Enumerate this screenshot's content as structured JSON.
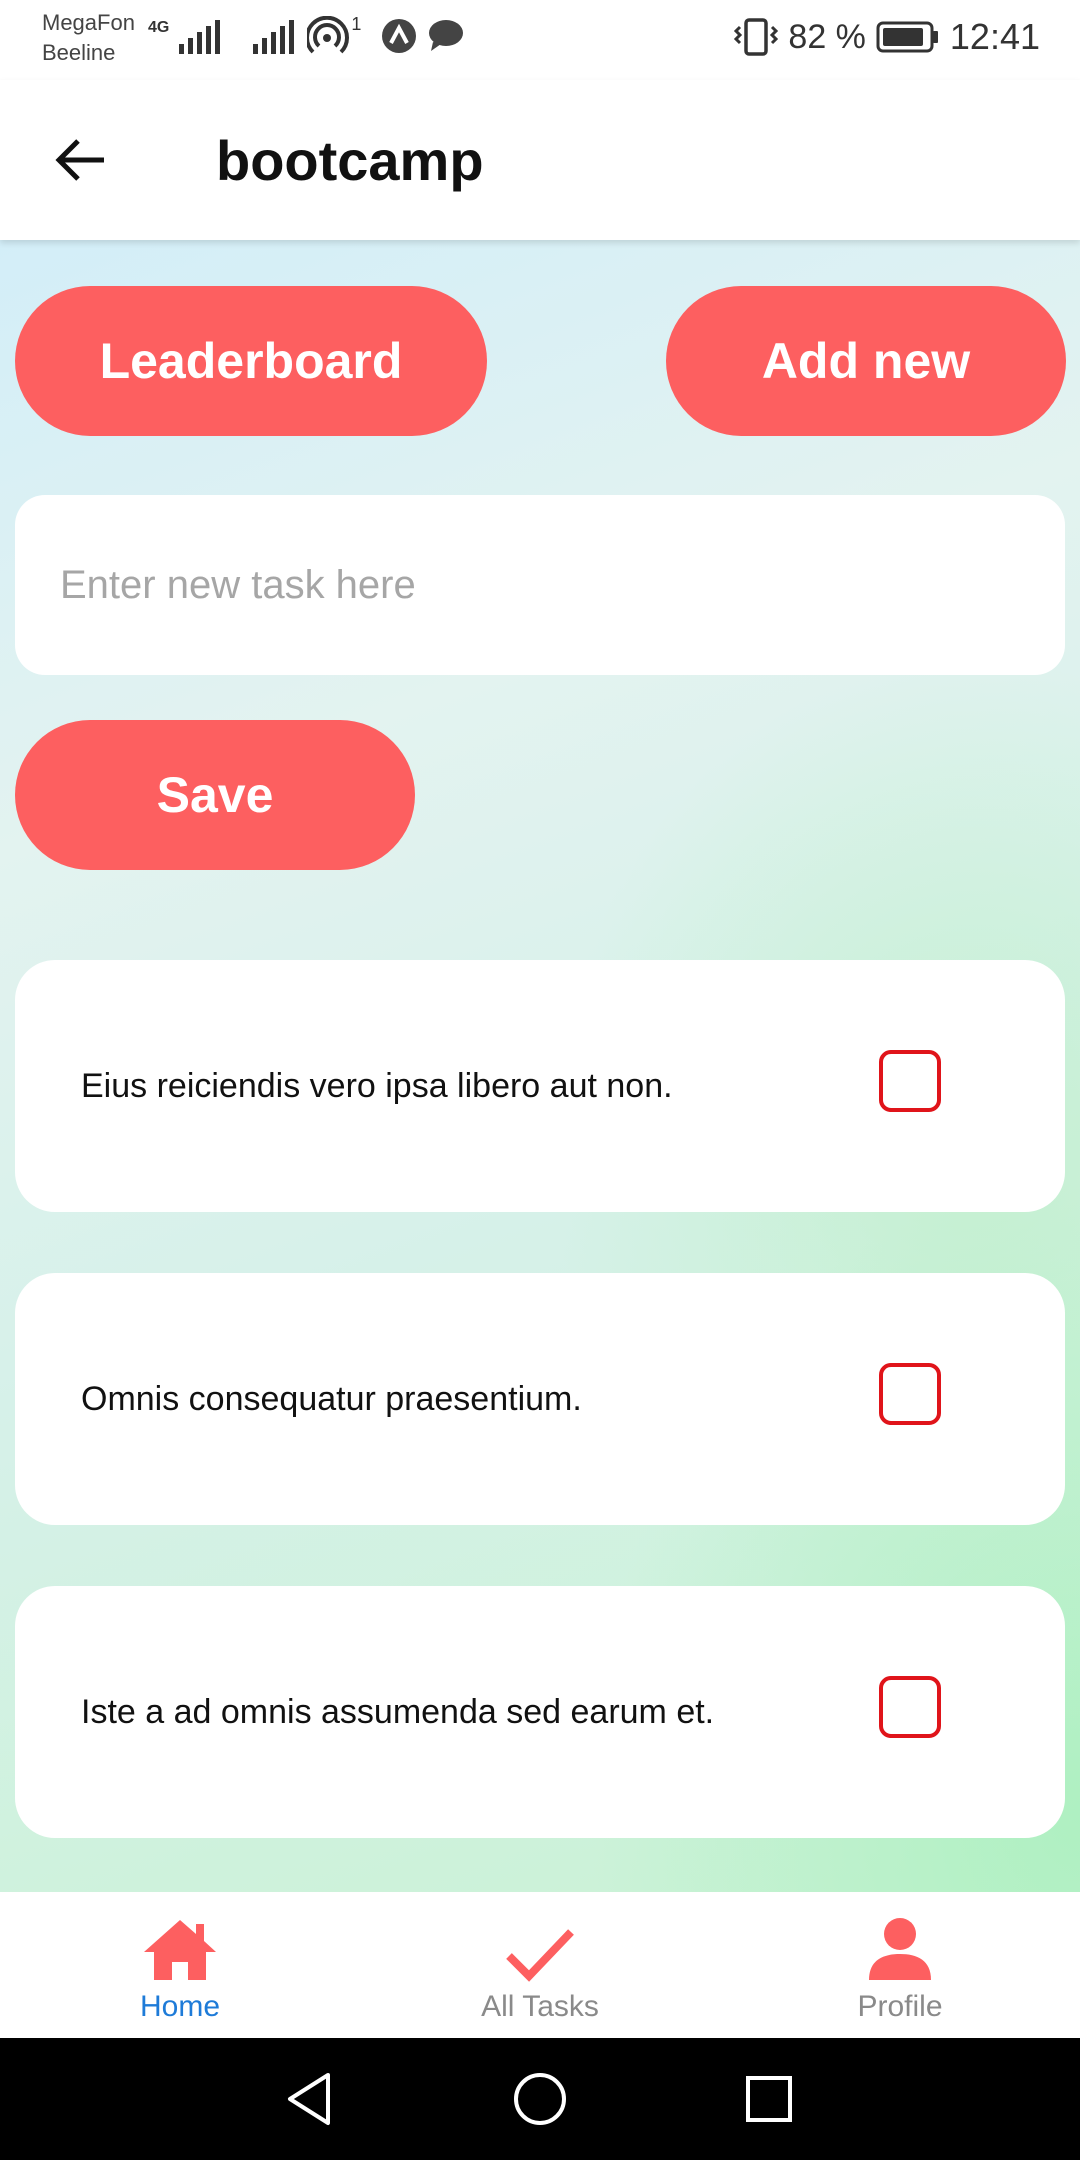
{
  "status_bar": {
    "carrier_1": "MegaFon",
    "carrier_2": "Beeline",
    "network_type": "4G",
    "hotspot_count": "1",
    "battery": "82 %",
    "time": "12:41",
    "icons": [
      "signal-icon",
      "signal-icon",
      "hotspot-icon",
      "app-notification-icon",
      "message-icon",
      "vibrate-icon",
      "battery-icon"
    ]
  },
  "appbar": {
    "title": "bootcamp",
    "back_icon": "arrow-left-icon"
  },
  "actions": {
    "leaderboard_label": "Leaderboard",
    "add_new_label": "Add new",
    "save_label": "Save"
  },
  "task_input": {
    "placeholder": "Enter new task here",
    "value": ""
  },
  "tasks": [
    {
      "text": "Eius reiciendis vero ipsa libero aut non.",
      "checked": false
    },
    {
      "text": "Omnis consequatur praesentium.",
      "checked": false
    },
    {
      "text": "Iste a ad omnis assumenda sed earum et.",
      "checked": false
    }
  ],
  "bottom_nav": {
    "items": [
      {
        "label": "Home",
        "icon": "home-icon",
        "active": true
      },
      {
        "label": "All Tasks",
        "icon": "check-icon",
        "active": false
      },
      {
        "label": "Profile",
        "icon": "person-icon",
        "active": false
      }
    ]
  },
  "colors": {
    "accent": "#fd5f60",
    "active_nav": "#1e7bd8",
    "checkbox": "#e0141a"
  }
}
